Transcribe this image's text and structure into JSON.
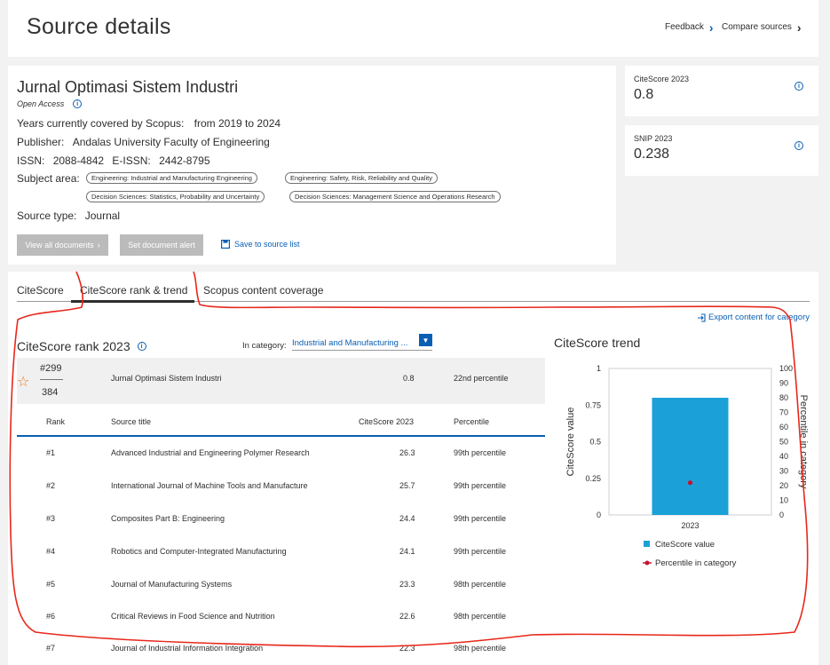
{
  "header": {
    "title": "Source details",
    "feedback": "Feedback",
    "compare": "Compare sources"
  },
  "source": {
    "title": "Jurnal Optimasi Sistem Industri",
    "open_access": "Open Access",
    "years_label": "Years currently covered by Scopus:",
    "years_value": "from 2019 to 2024",
    "publisher_label": "Publisher:",
    "publisher_value": "Andalas University Faculty of Engineering",
    "issn_label": "ISSN:",
    "issn_value": "2088-4842",
    "eissn_label": "E-ISSN:",
    "eissn_value": "2442-8795",
    "subject_label": "Subject area:",
    "subjects": [
      "Engineering: Industrial and Manufacturing Engineering",
      "Engineering: Safety, Risk, Reliability and Quality",
      "Decision Sciences: Statistics, Probability and Uncertainty",
      "Decision Sciences: Management Science and Operations Research"
    ],
    "type_label": "Source type:",
    "type_value": "Journal",
    "view_all_button": "View all documents",
    "alert_button": "Set document alert",
    "save_link": "Save to source list"
  },
  "metrics": [
    {
      "label": "CiteScore 2023",
      "value": "0.8"
    },
    {
      "label": "SNIP 2023",
      "value": "0.238"
    }
  ],
  "tabs": [
    {
      "label": "CiteScore"
    },
    {
      "label": "CiteScore rank & trend"
    },
    {
      "label": "Scopus content coverage"
    }
  ],
  "export": "Export content for category",
  "rank": {
    "title": "CiteScore rank 2023",
    "category_label": "In category:",
    "category_value": "Industrial and Manufacturing ...",
    "current": {
      "rank": "#299",
      "total": "384",
      "title": "Jurnal Optimasi Sistem Industri",
      "score": "0.8",
      "percentile": "22nd percentile"
    },
    "columns": [
      "Rank",
      "Source title",
      "CiteScore 2023",
      "Percentile"
    ],
    "rows": [
      {
        "rank": "#1",
        "title": "Advanced Industrial and Engineering Polymer Research",
        "score": "26.3",
        "percentile": "99th percentile"
      },
      {
        "rank": "#2",
        "title": "International Journal of Machine Tools and Manufacture",
        "score": "25.7",
        "percentile": "99th percentile"
      },
      {
        "rank": "#3",
        "title": "Composites Part B: Engineering",
        "score": "24.4",
        "percentile": "99th percentile"
      },
      {
        "rank": "#4",
        "title": "Robotics and Computer-Integrated Manufacturing",
        "score": "24.1",
        "percentile": "99th percentile"
      },
      {
        "rank": "#5",
        "title": "Journal of Manufacturing Systems",
        "score": "23.3",
        "percentile": "98th percentile"
      },
      {
        "rank": "#6",
        "title": "Critical Reviews in Food Science and Nutrition",
        "score": "22.6",
        "percentile": "98th percentile"
      },
      {
        "rank": "#7",
        "title": "Journal of Industrial Information Integration",
        "score": "22.3",
        "percentile": "98th percentile"
      }
    ]
  },
  "trend": {
    "title": "CiteScore trend",
    "chart_data": {
      "type": "bar",
      "categories": [
        "2023"
      ],
      "series": [
        {
          "name": "CiteScore value",
          "values": [
            0.8
          ],
          "axis": "left",
          "color": "#1ba1d8"
        },
        {
          "name": "Percentile in category",
          "values": [
            22
          ],
          "axis": "right",
          "color": "#c8102e",
          "mark": "point"
        }
      ],
      "ylabel": "CiteScore value",
      "y2label": "Percentile in category",
      "ylim": [
        0,
        1
      ],
      "y2lim": [
        0,
        100
      ],
      "yticks": [
        "0",
        "0.25",
        "0.5",
        "0.75",
        "1"
      ],
      "y2ticks": [
        "0",
        "10",
        "20",
        "30",
        "40",
        "50",
        "60",
        "70",
        "80",
        "90",
        "100"
      ],
      "legend": "bottom"
    }
  },
  "colors": {
    "link": "#0a5fb4",
    "annotation": "#e8271b",
    "star": "#e6761b"
  }
}
